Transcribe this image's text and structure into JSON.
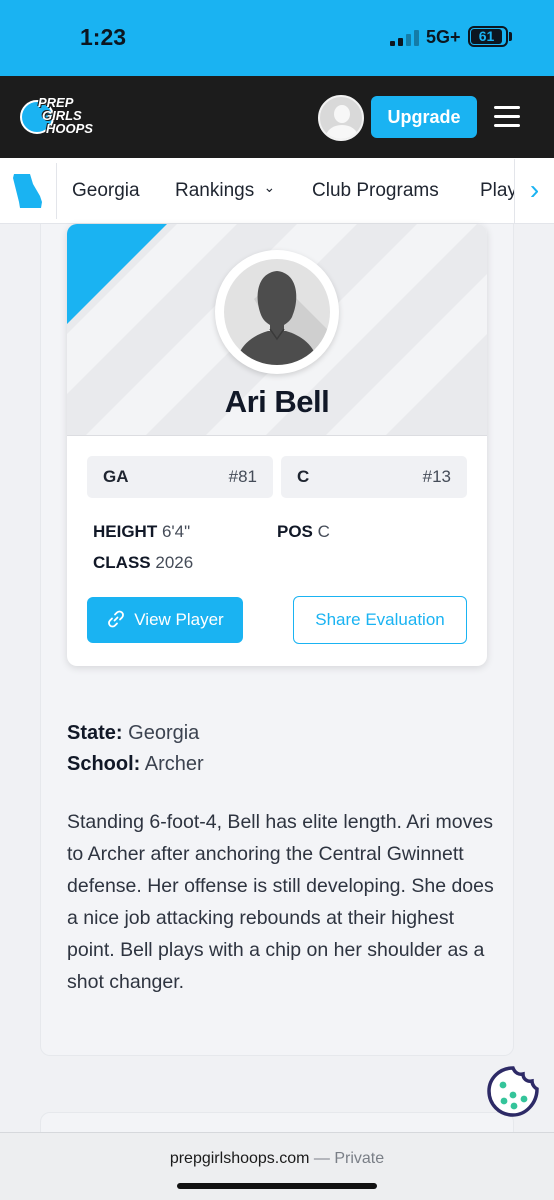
{
  "status_bar": {
    "time": "1:23",
    "network": "5G+",
    "battery": "61"
  },
  "header": {
    "logo_lines": [
      "PREP",
      "GIRLS",
      "HOOPS"
    ],
    "upgrade_label": "Upgrade"
  },
  "nav": {
    "items": [
      {
        "label": "Georgia"
      },
      {
        "label": "Rankings",
        "chevron": "⌄"
      },
      {
        "label": "Club Programs"
      },
      {
        "label": "Play"
      }
    ],
    "next_icon": "›"
  },
  "player": {
    "name": "Ari Bell",
    "state_abbr": "GA",
    "state_rank": "#81",
    "position_abbr": "C",
    "position_rank": "#13",
    "height_label": "HEIGHT",
    "height_value": "6'4\"",
    "pos_label": "POS",
    "pos_value": "C",
    "class_label": "CLASS",
    "class_value": "2026",
    "view_button": "View Player",
    "share_button": "Share Evaluation"
  },
  "details": {
    "state_label": "State:",
    "state_value": "Georgia",
    "school_label": "School:",
    "school_value": "Archer",
    "bio": "Standing 6-foot-4, Bell has elite length. Ari moves to Archer after anchoring the Central Gwinnett defense. Her offense is still developing. She does a nice job attacking rebounds at their highest point. Bell plays with a chip on her shoulder as a shot changer."
  },
  "browser": {
    "url": "prepgirlshoops.com",
    "private_label": "— Private"
  },
  "colors": {
    "accent": "#1ab3f2",
    "header_bg": "#1c1c1c",
    "cookie": "#2d2a66"
  }
}
